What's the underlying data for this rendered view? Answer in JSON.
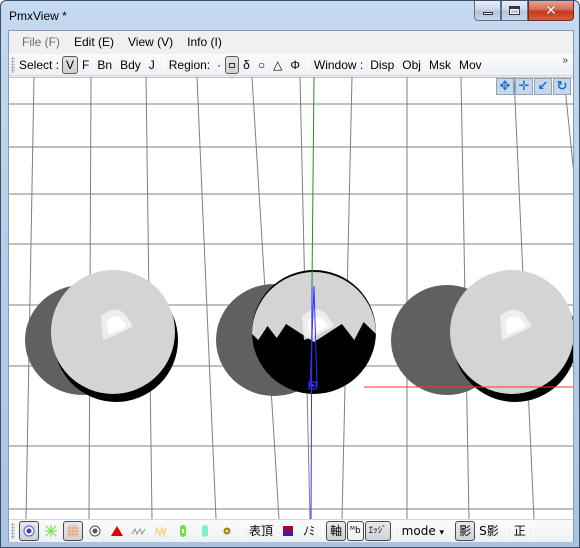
{
  "window": {
    "title": "PmxView *",
    "minimize_glyph": "",
    "close_glyph": "✕"
  },
  "menubar": {
    "items": [
      {
        "label": "File (F)",
        "enabled": false
      },
      {
        "label": "Edit (E)",
        "enabled": true
      },
      {
        "label": "View (V)",
        "enabled": true
      },
      {
        "label": "Info (I)",
        "enabled": true
      }
    ]
  },
  "toolbar_top": {
    "select_label": "Select :",
    "select_buttons": [
      {
        "label": "V",
        "pressed": true
      },
      {
        "label": "F",
        "pressed": false
      },
      {
        "label": "Bn",
        "pressed": false
      },
      {
        "label": "Bdy",
        "pressed": false
      },
      {
        "label": "J",
        "pressed": false
      }
    ],
    "region_label": "Region:",
    "region_buttons": [
      {
        "label": "·",
        "name": "point",
        "pressed": false
      },
      {
        "label": "",
        "name": "rectangle",
        "pressed": true
      },
      {
        "label": "δ",
        "name": "lasso",
        "pressed": false
      },
      {
        "label": "○",
        "name": "circle",
        "pressed": false
      },
      {
        "label": "△",
        "name": "triangle",
        "pressed": false
      },
      {
        "label": "Φ",
        "name": "phi",
        "pressed": false
      }
    ],
    "window_label": "Window :",
    "window_buttons": [
      {
        "label": "Disp"
      },
      {
        "label": "Obj"
      },
      {
        "label": "Msk"
      },
      {
        "label": "Mov"
      }
    ],
    "overflow_glyph": "»"
  },
  "viewport": {
    "nav_icons": [
      {
        "name": "rotate-view-icon",
        "glyph": "✥"
      },
      {
        "name": "pan-view-icon",
        "glyph": "✛"
      },
      {
        "name": "zoom-view-icon",
        "glyph": "↙"
      },
      {
        "name": "reset-rotate-icon",
        "glyph": "↻"
      }
    ],
    "colors": {
      "grid": "#808080",
      "axis_x": "#ff3333",
      "axis_y": "#2f8a2f",
      "axis_z": "#3333ff",
      "sphere_light": "#d4d4d4",
      "shadow": "#606060",
      "dark": "#000000"
    },
    "objects": [
      {
        "name": "sphere-left",
        "state": "lit"
      },
      {
        "name": "sphere-center",
        "state": "selected-partially-dark"
      },
      {
        "name": "sphere-right",
        "state": "lit"
      }
    ]
  },
  "toolbar_bottom": {
    "icon_buttons": [
      {
        "name": "vertex-display-icon",
        "pressed": true,
        "color": "#3a3ad0"
      },
      {
        "name": "vertex-spark-icon",
        "pressed": false,
        "color": "#7de04a"
      },
      {
        "name": "vertex-grid-icon",
        "pressed": true,
        "color": "#f0a060"
      },
      {
        "name": "target-icon",
        "pressed": false,
        "color": "#555555"
      },
      {
        "name": "red-triangle-icon",
        "pressed": false,
        "color": "#e00000"
      },
      {
        "name": "bone-chain-icon",
        "pressed": false,
        "color": "#909090"
      },
      {
        "name": "ik-icon",
        "pressed": false,
        "color": "#f5d070"
      },
      {
        "name": "green-capsule-icon",
        "pressed": false,
        "color": "#70e040"
      },
      {
        "name": "cyan-capsule-icon",
        "pressed": false,
        "color": "#80f0d0"
      },
      {
        "name": "joint-icon",
        "pressed": false,
        "color": "#a08010"
      }
    ],
    "surface_label": "表頂",
    "material_color_top": "#cc0000",
    "material_color_bottom": "#2020cc",
    "normal_label": "ﾉﾐ",
    "axis_label": "軸",
    "mb_label": "ᴹb",
    "edge_label": "ｴｯｼﾞ",
    "mode_label": "mode",
    "mode_arrow": "▾",
    "shadow_label": "影",
    "self_shadow_label": "S影",
    "front_label": "正"
  }
}
